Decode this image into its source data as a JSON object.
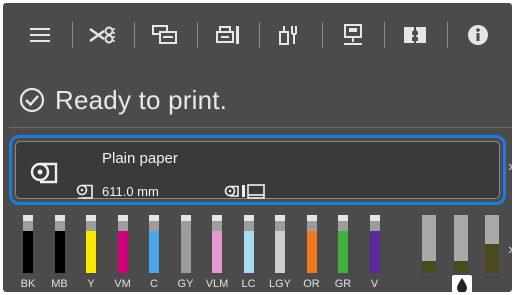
{
  "toolbar": {
    "items": [
      {
        "icon": "menu-icon"
      },
      {
        "icon": "paper-cutter-icon"
      },
      {
        "icon": "paper-settings-icon"
      },
      {
        "icon": "printer-maintenance-icon"
      },
      {
        "icon": "tools-icon"
      },
      {
        "icon": "network-printer-icon"
      },
      {
        "icon": "guide-book-icon"
      },
      {
        "icon": "info-icon"
      }
    ]
  },
  "status": {
    "icon": "check-circle-icon",
    "text": "Ready to print."
  },
  "paper": {
    "type": "Plain paper",
    "length": "611.0 mm",
    "roll_icon": "roll-paper-icon"
  },
  "inks": [
    {
      "label": "BK",
      "color": "#000000",
      "level": 0.72
    },
    {
      "label": "MB",
      "color": "#000000",
      "level": 0.72
    },
    {
      "label": "Y",
      "color": "#ffe800",
      "level": 0.72
    },
    {
      "label": "VM",
      "color": "#d0007a",
      "level": 0.72
    },
    {
      "label": "C",
      "color": "#4aa8e8",
      "level": 0.72
    },
    {
      "label": "GY",
      "color": "#9a9a9a",
      "level": 0.72
    },
    {
      "label": "VLM",
      "color": "#e89ad0",
      "level": 0.72
    },
    {
      "label": "LC",
      "color": "#a8dcf0",
      "level": 0.72
    },
    {
      "label": "LGY",
      "color": "#d0d0d0",
      "level": 0.72
    },
    {
      "label": "OR",
      "color": "#f07a20",
      "level": 0.72
    },
    {
      "label": "GR",
      "color": "#40b040",
      "level": 0.72
    },
    {
      "label": "V",
      "color": "#5a2a9a",
      "level": 0.72
    }
  ],
  "maintenance": [
    {
      "level": 0.2
    },
    {
      "level": 0.2
    },
    {
      "level": 0.5
    }
  ],
  "colors": {
    "accent": "#1a7be0",
    "background": "#4b4b4b"
  }
}
